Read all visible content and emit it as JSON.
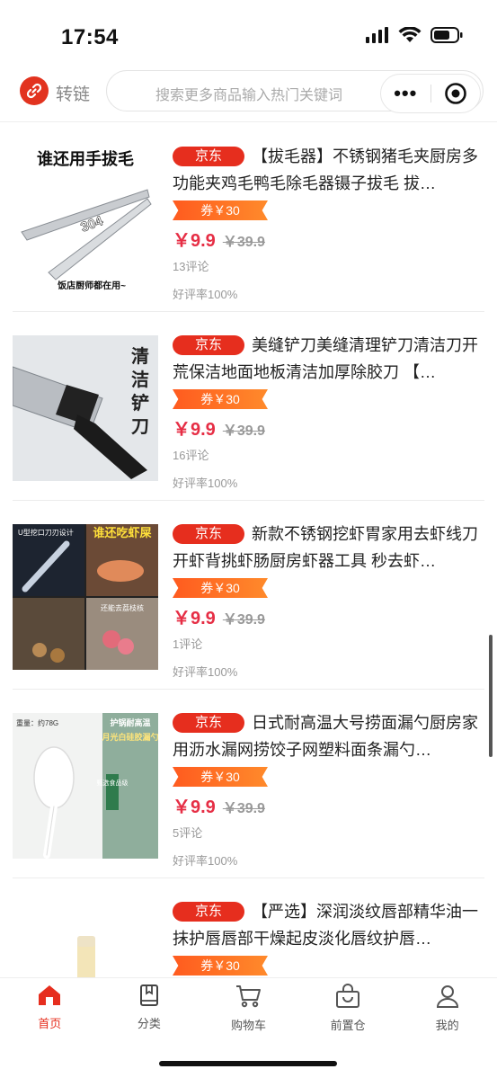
{
  "status": {
    "time": "17:54"
  },
  "nav": {
    "logo_label": "转链",
    "search_placeholder": "搜索更多商品输入热门关键词",
    "more_dots": "•••"
  },
  "products": [
    {
      "platform": "京东",
      "title": "【拔毛器】不锈钢猪毛夹厨房多功能夹鸡毛鸭毛除毛器镊子拔毛 拔…",
      "coupon": "券￥30",
      "price": "￥9.9",
      "original_price": "￥39.9",
      "comments": "13评论",
      "rating": "好评率100%",
      "image_text": [
        "谁还用手拔毛",
        "304",
        "饭店厨师都在用~"
      ]
    },
    {
      "platform": "京东",
      "title": "美缝铲刀美缝清理铲刀清洁刀开荒保洁地面地板清洁加厚除胶刀 【…",
      "coupon": "券￥30",
      "price": "￥9.9",
      "original_price": "￥39.9",
      "comments": "16评论",
      "rating": "好评率100%",
      "image_text": [
        "清",
        "洁",
        "铲",
        "刀"
      ]
    },
    {
      "platform": "京东",
      "title": "新款不锈钢挖虾胃家用去虾线刀开虾背挑虾肠厨房虾器工具 秒去虾…",
      "coupon": "券￥30",
      "price": "￥9.9",
      "original_price": "￥39.9",
      "comments": "1评论",
      "rating": "好评率100%",
      "image_text": [
        "U型挖口刀刃设计",
        "谁还吃虾屎",
        "还能去荔枝核"
      ]
    },
    {
      "platform": "京东",
      "title": "日式耐高温大号捞面漏勺厨房家用沥水漏网捞饺子网塑料面条漏勺…",
      "coupon": "券￥30",
      "price": "￥9.9",
      "original_price": "￥39.9",
      "comments": "5评论",
      "rating": "好评率100%",
      "image_text": [
        "重量：约78G",
        "护锅耐高温",
        "月光白硅胶漏勺",
        "甄选食品级"
      ]
    },
    {
      "platform": "京东",
      "title": "【严选】深润淡纹唇部精华油一抹护唇唇部干燥起皮淡化唇纹护唇…",
      "coupon": "券￥30",
      "price": "",
      "original_price": "",
      "comments": "",
      "rating": "",
      "image_text": []
    }
  ],
  "tabs": [
    {
      "label": "首页",
      "icon": "home-icon",
      "active": true
    },
    {
      "label": "分类",
      "icon": "book-icon",
      "active": false
    },
    {
      "label": "购物车",
      "icon": "cart-icon",
      "active": false
    },
    {
      "label": "前置仓",
      "icon": "bag-icon",
      "active": false
    },
    {
      "label": "我的",
      "icon": "user-icon",
      "active": false
    }
  ],
  "colors": {
    "accent": "#e62e1e",
    "price": "#e62e45",
    "coupon": "#ff6a26"
  }
}
